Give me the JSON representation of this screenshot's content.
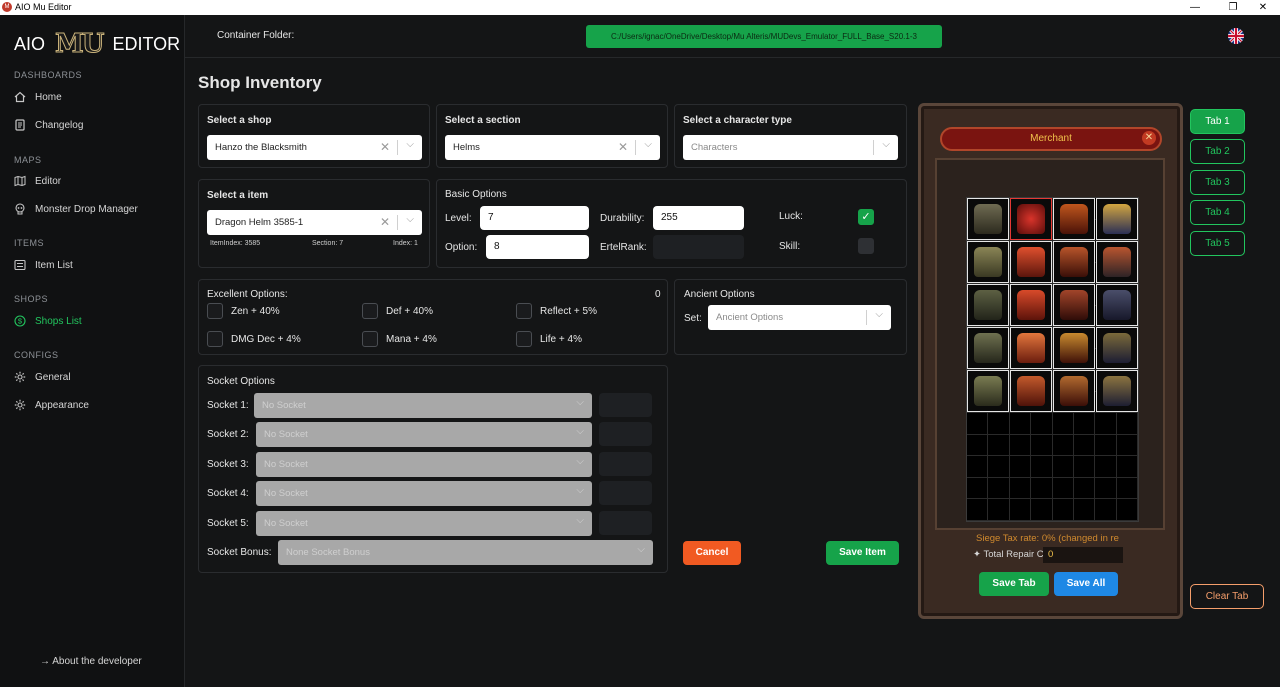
{
  "window": {
    "title": "AIO Mu Editor",
    "controls": {
      "minimize": "—",
      "maximize": "❐",
      "close": "✕"
    }
  },
  "logo": {
    "left": "AIO",
    "mu": "MU",
    "right": "EDITOR"
  },
  "sidebar": {
    "sections": [
      {
        "label": "DASHBOARDS"
      },
      {
        "label": "MAPS"
      },
      {
        "label": "ITEMS"
      },
      {
        "label": "SHOPS"
      },
      {
        "label": "CONFIGS"
      }
    ],
    "items": [
      {
        "label": "Home",
        "icon": "home-icon"
      },
      {
        "label": "Changelog",
        "icon": "document-icon"
      },
      {
        "label": "Editor",
        "icon": "map-icon"
      },
      {
        "label": "Monster Drop Manager",
        "icon": "skull-icon"
      },
      {
        "label": "Item List",
        "icon": "list-icon"
      },
      {
        "label": "Shops List",
        "icon": "dollar-icon"
      },
      {
        "label": "General",
        "icon": "gear-icon"
      },
      {
        "label": "Appearance",
        "icon": "gear-icon"
      }
    ],
    "active_color": "#22c55e",
    "about": "→ About the developer"
  },
  "topbar": {
    "container_label": "Container Folder:",
    "container_path": "C:/Users/ignac/OneDrive/Desktop/Mu Alteris/MUDevs_Emulator_FULL_Base_S20.1-3",
    "language": "uk-flag-icon"
  },
  "page": {
    "title": "Shop Inventory"
  },
  "shop_select": {
    "label": "Select a shop",
    "value": "Hanzo the Blacksmith"
  },
  "section_select": {
    "label": "Select a section",
    "value": "Helms"
  },
  "chartype_select": {
    "label": "Select a character type",
    "placeholder": "Characters"
  },
  "item_select": {
    "label": "Select a item",
    "value": "Dragon Helm 3585-1",
    "meta": {
      "item_index": "ItemIndex: 3585",
      "section": "Section: 7",
      "index": "Index: 1"
    }
  },
  "basic_options": {
    "title": "Basic Options",
    "level_label": "Level:",
    "level": "7",
    "option_label": "Option:",
    "option": "8",
    "durability_label": "Durability:",
    "durability": "255",
    "ertel_label": "ErtelRank:",
    "ertel": "",
    "luck_label": "Luck:",
    "luck": true,
    "skill_label": "Skill:",
    "skill": false
  },
  "excellent_options": {
    "title": "Excellent Options:",
    "count": "0",
    "options": [
      "Zen + 40%",
      "Def + 40%",
      "Reflect + 5%",
      "DMG Dec + 4%",
      "Mana + 4%",
      "Life + 4%"
    ]
  },
  "ancient_options": {
    "title": "Ancient Options",
    "set_label": "Set:",
    "placeholder": "Ancient Options"
  },
  "socket_options": {
    "title": "Socket Options",
    "sockets": [
      {
        "label": "Socket 1:",
        "value": "No Socket"
      },
      {
        "label": "Socket 2:",
        "value": "No Socket"
      },
      {
        "label": "Socket 3:",
        "value": "No Socket"
      },
      {
        "label": "Socket 4:",
        "value": "No Socket"
      },
      {
        "label": "Socket 5:",
        "value": "No Socket"
      }
    ],
    "bonus_label": "Socket Bonus:",
    "bonus_value": "None Socket Bonus"
  },
  "actions": {
    "cancel": "Cancel",
    "save_item": "Save Item"
  },
  "inventory": {
    "header": "Merchant",
    "close": "✕",
    "siege_tax": "Siege Tax rate: 0% (changed in re",
    "total_repair_label": "Total Repair C",
    "total_repair_value": "0",
    "save_tab": "Save Tab",
    "save_all": "Save All"
  },
  "tabs": [
    "Tab 1",
    "Tab 2",
    "Tab 3",
    "Tab 4",
    "Tab 5"
  ],
  "clear_tab": "Clear Tab"
}
